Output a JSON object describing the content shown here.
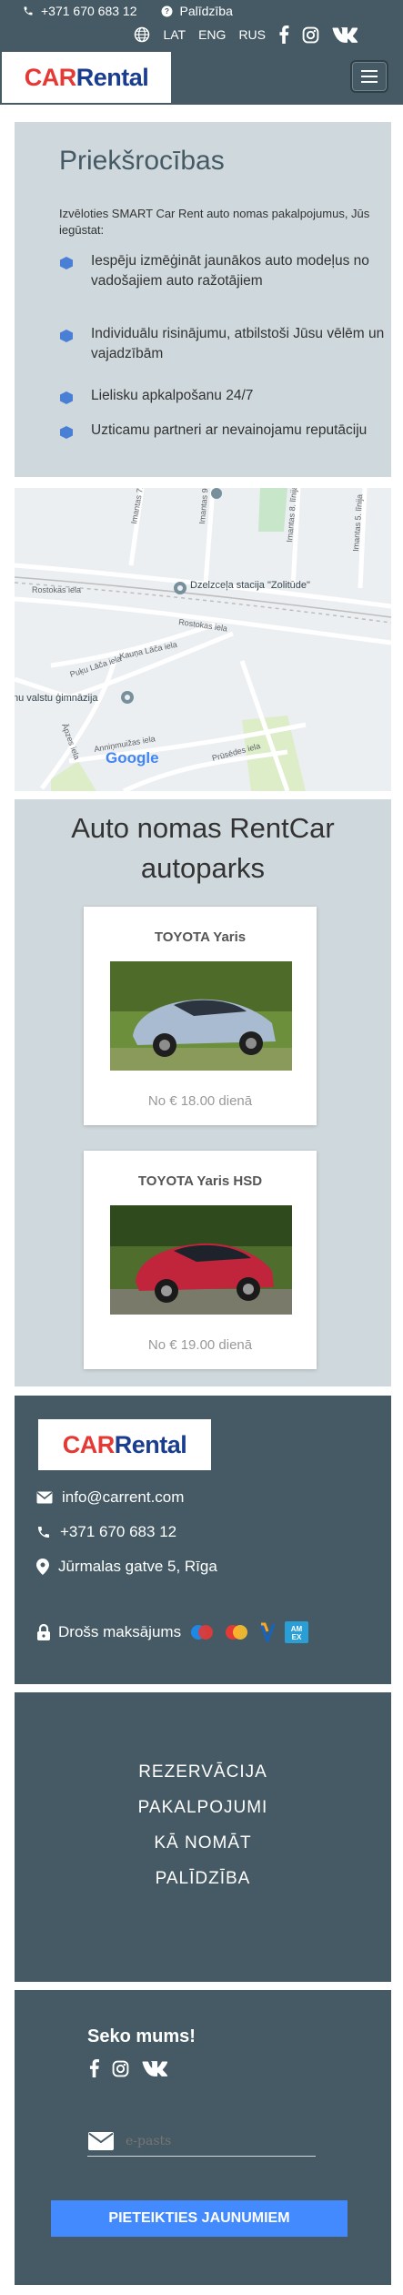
{
  "topbar": {
    "phone": "+371 670 683 12",
    "help": "Palīdzība",
    "languages": [
      "LAT",
      "ENG",
      "RUS"
    ]
  },
  "brand": {
    "part1": "CAR",
    "part2": "Rental"
  },
  "advantages": {
    "title": "Priekšrocības",
    "intro": "Izvēloties SMART Car Rent auto nomas pakalpojumus, Jūs iegūstat:",
    "items": [
      "Iespēju izmēģināt jaunākos auto modeļus no vadošajiem auto ražotājiem",
      "Individuālu risinājumu, atbilstoši Jūsu vēlēm un vajadzībām",
      "Lielisku apkalpošanu 24/7",
      "Uzticamu partneri ar nevainojamu reputāciju"
    ]
  },
  "map": {
    "place_label": "Dzelzceļa stacija \"Zolitūde\"",
    "streets": [
      "Rostokas iela",
      "Rostokas iela",
      "Kauņa Lāča iela",
      "Puķu Lāča iela",
      "Āpzes iela",
      "Anniņmuižas iela",
      "Prūsēdes iela",
      "Imantas 7. līnija",
      "Imantas 9. līnija",
      "Imantas 8. līnija",
      "Imantas 5. līnija"
    ],
    "school_label": "nu valstu ģimnāzija",
    "google": "Google"
  },
  "fleet": {
    "title": "Auto nomas RentCar autoparks",
    "cars": [
      {
        "name": "TOYOTA Yaris",
        "price": "No € 18.00 dienā"
      },
      {
        "name": "TOYOTA Yaris HSD",
        "price": "No € 19.00 dienā"
      }
    ]
  },
  "contact": {
    "email": "info@carrent.com",
    "phone": "+371 670 683 12",
    "address": "Jūrmalas gatve 5, Rīga",
    "secure_payment": "Drošs maksājums"
  },
  "links": [
    "REZERVĀCIJA",
    "PAKALPOJUMI",
    "KĀ NOMĀT",
    "PALĪDZĪBA"
  ],
  "follow": {
    "title": "Seko mums!",
    "email_placeholder": "e-pasts",
    "subscribe_label": "PIETEIKTIES JAUNUMIEM"
  },
  "colors": {
    "primary": "#455a64",
    "panel": "#cfd8dc",
    "accent": "#448aff",
    "brand_red": "#e53935",
    "brand_blue": "#1a3d8f"
  }
}
